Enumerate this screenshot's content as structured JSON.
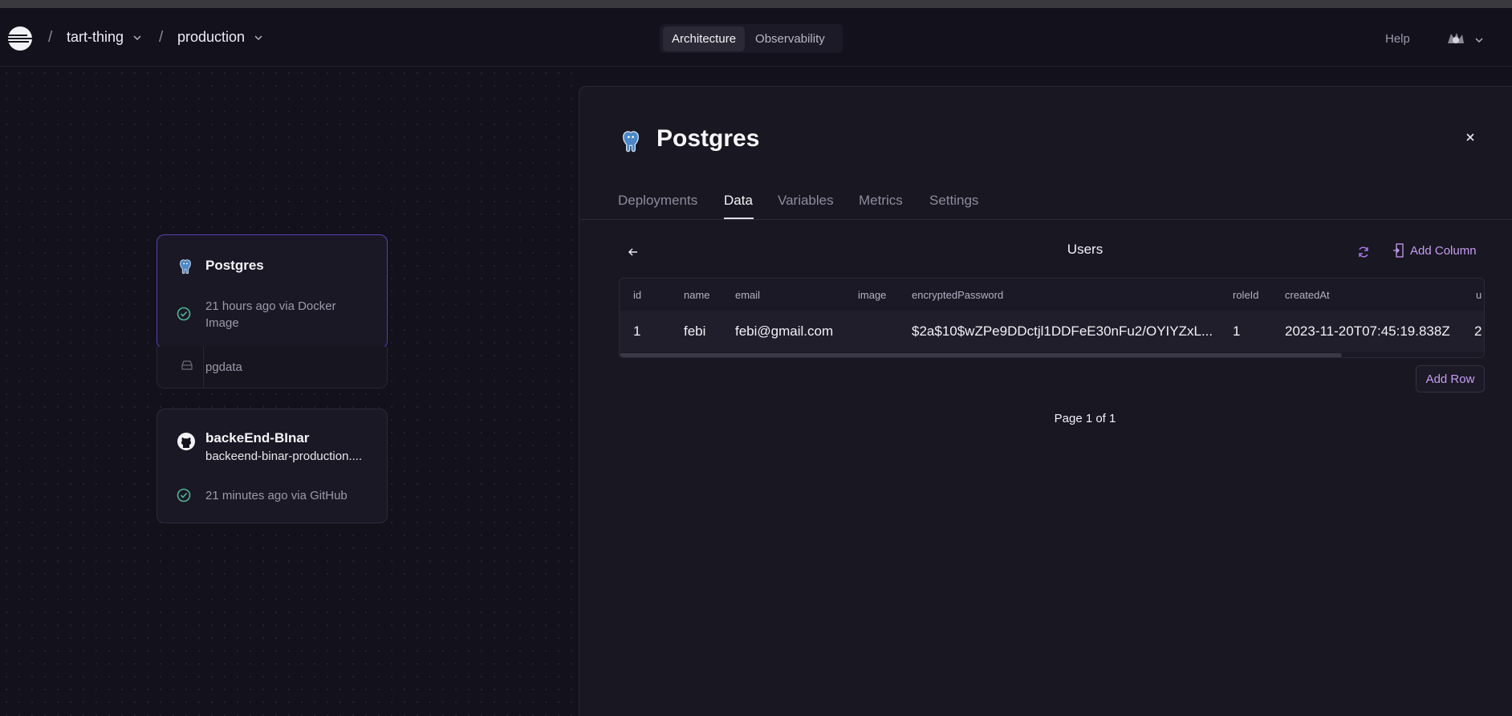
{
  "header": {
    "project": "tart-thing",
    "environment": "production",
    "separator": "/",
    "tabs": [
      {
        "label": "Architecture",
        "active": true
      },
      {
        "label": "Observability",
        "active": false
      }
    ],
    "help": "Help"
  },
  "canvas": {
    "services": [
      {
        "name": "Postgres",
        "status": "21 hours ago via Docker Image",
        "status_line1": "21 hours ago via Docker",
        "status_line2": "Image",
        "icon": "postgres-icon",
        "volume": "pgdata"
      },
      {
        "name": "backeEnd-BInar",
        "url": "backeend-binar-production....",
        "status": "21 minutes ago via GitHub",
        "icon": "github-icon"
      }
    ]
  },
  "panel": {
    "title": "Postgres",
    "tabs": [
      {
        "label": "Deployments",
        "active": false
      },
      {
        "label": "Data",
        "active": true
      },
      {
        "label": "Variables",
        "active": false
      },
      {
        "label": "Metrics",
        "active": false
      },
      {
        "label": "Settings",
        "active": false
      }
    ],
    "table": {
      "name": "Users",
      "add_column": "Add Column",
      "add_row": "Add Row",
      "columns": [
        "id",
        "name",
        "email",
        "image",
        "encryptedPassword",
        "roleId",
        "createdAt",
        "u"
      ],
      "rows": [
        [
          "1",
          "febi",
          "febi@gmail.com",
          "",
          "$2a$10$wZPe9DDctjl1DDFeE30nFu2/OYIYZxL...",
          "1",
          "2023-11-20T07:45:19.838Z",
          "2"
        ]
      ],
      "pagination": "Page 1 of 1"
    }
  },
  "colors": {
    "accent": "#c79cf2",
    "success": "#4fb59a",
    "selected_border": "#5d3fb0",
    "background": "#13111c"
  }
}
